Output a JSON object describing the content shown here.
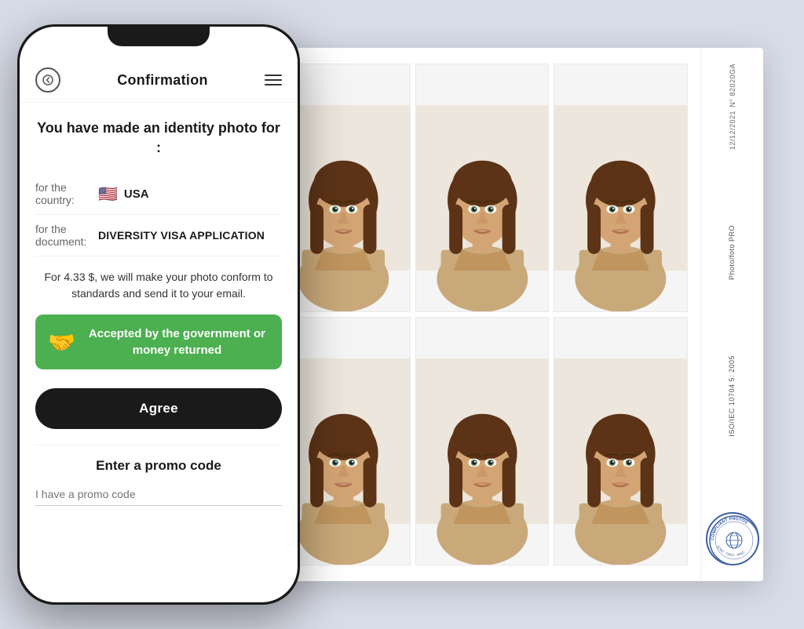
{
  "phone": {
    "nav": {
      "back_label": "←",
      "title": "Confirmation",
      "menu_label": "≡"
    },
    "content": {
      "section_title": "You have made an identity photo for :",
      "country_label": "for the country:",
      "country_flag": "🇺🇸",
      "country_name": "USA",
      "document_label": "for the document:",
      "document_name": "DIVERSITY VISA APPLICATION",
      "price_text": "For 4.33 $, we will make your photo conform to standards and send it to your email.",
      "guarantee_text": "Accepted by the government or money returned",
      "guarantee_icon": "🤝",
      "agree_button": "Agree",
      "promo_title": "Enter a promo code",
      "promo_placeholder": "I have a promo code"
    }
  },
  "photo_sheet": {
    "serial_number": "N° 82020GA",
    "date": "12/12/2021",
    "brand_text": "Photo/foto PRO",
    "iso_text": "ISO/IEC 10704 5: 2005",
    "stamp_text": "COMPLIANT PHOTOS",
    "stamp_subtext": "ICAO OACI MAO"
  }
}
